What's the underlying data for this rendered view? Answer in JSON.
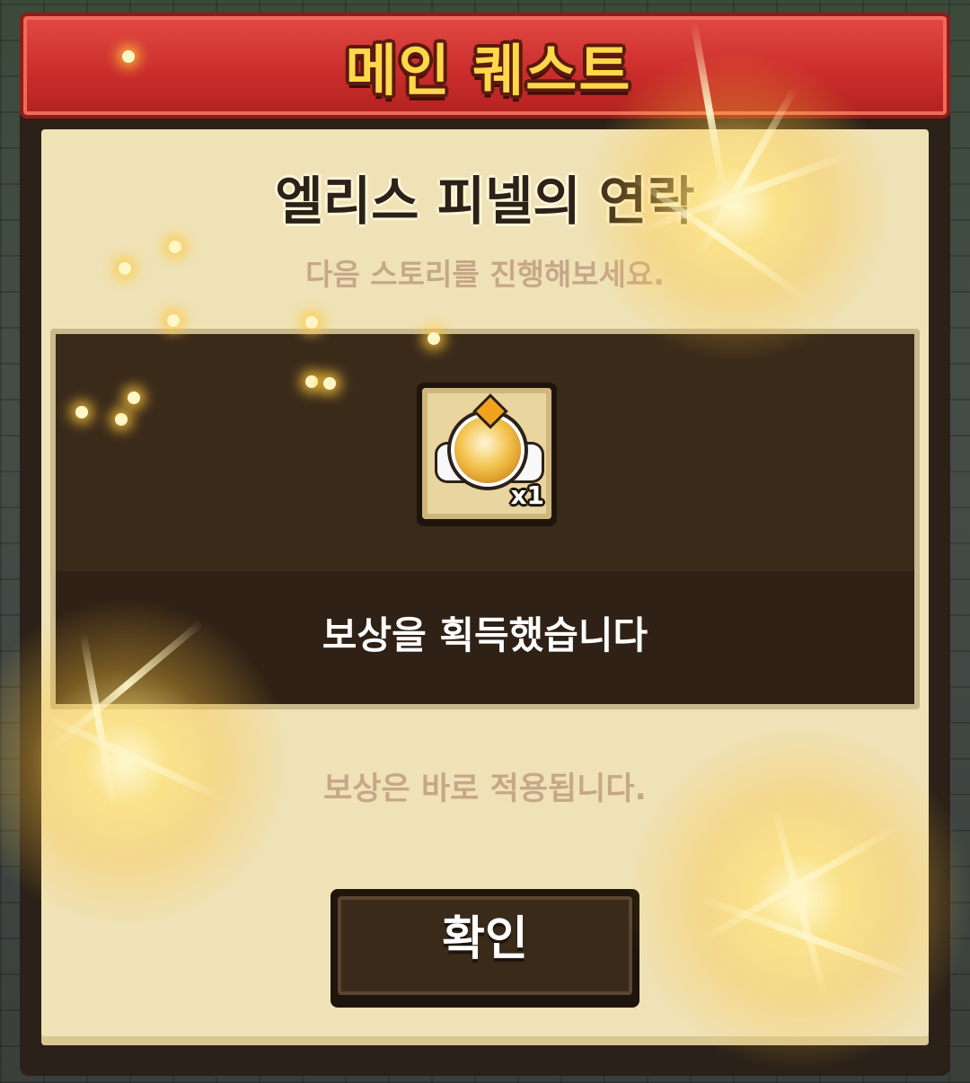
{
  "dialog": {
    "header_title": "메인 퀘스트",
    "quest_title": "엘리스 피넬의 연락",
    "quest_subtitle": "다음 스토리를 진행해보세요.",
    "reward": {
      "icon": "golden-orb-icon",
      "quantity": "x1",
      "message": "보상을 획득했습니다"
    },
    "notice": "보상은 바로 적용됩니다.",
    "confirm_label": "확인"
  },
  "colors": {
    "banner_red": "#cc2e2c",
    "banner_text": "#ffd84a",
    "panel_cream": "#efe2b6",
    "dark_brown": "#2b2118",
    "muted_text": "#c7a78a"
  }
}
